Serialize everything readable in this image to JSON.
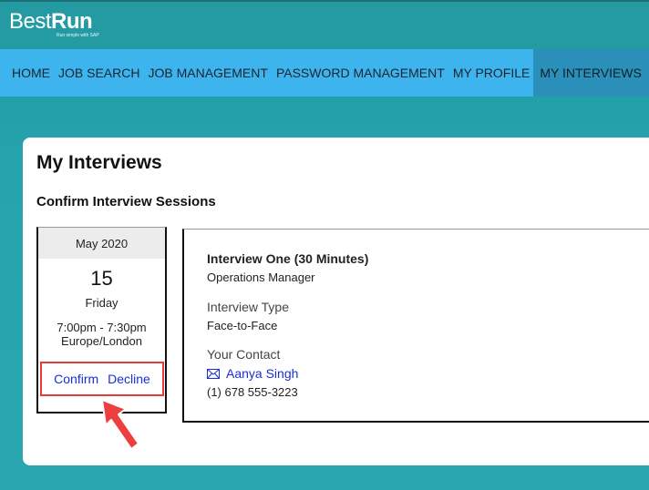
{
  "brand": {
    "name_part1": "Best",
    "name_part2": "Run",
    "tagline": "Run simple with SAP"
  },
  "nav": {
    "items": [
      "HOME",
      "JOB SEARCH",
      "JOB MANAGEMENT",
      "PASSWORD MANAGEMENT",
      "MY PROFILE",
      "MY INTERVIEWS"
    ],
    "active_index": 5
  },
  "page": {
    "title": "My Interviews",
    "section_title": "Confirm Interview Sessions"
  },
  "session": {
    "month": "May 2020",
    "day": "15",
    "weekday": "Friday",
    "time": "7:00pm - 7:30pm",
    "timezone": "Europe/London",
    "confirm_label": "Confirm",
    "decline_label": "Decline"
  },
  "interview": {
    "title": "Interview One (30 Minutes)",
    "position": "Operations Manager",
    "type_label": "Interview Type",
    "type_value": "Face-to-Face",
    "contact_label": "Your Contact",
    "contact_name": "Aanya Singh",
    "contact_phone": "(1) 678 555-3223"
  },
  "colors": {
    "nav_bg": "#3db4ee",
    "nav_active_bg": "#2a8fb9",
    "link": "#1a2fd6",
    "highlight": "#e53a3a"
  },
  "icons": {
    "contact": "mail-icon",
    "annotation": "arrow-icon"
  }
}
